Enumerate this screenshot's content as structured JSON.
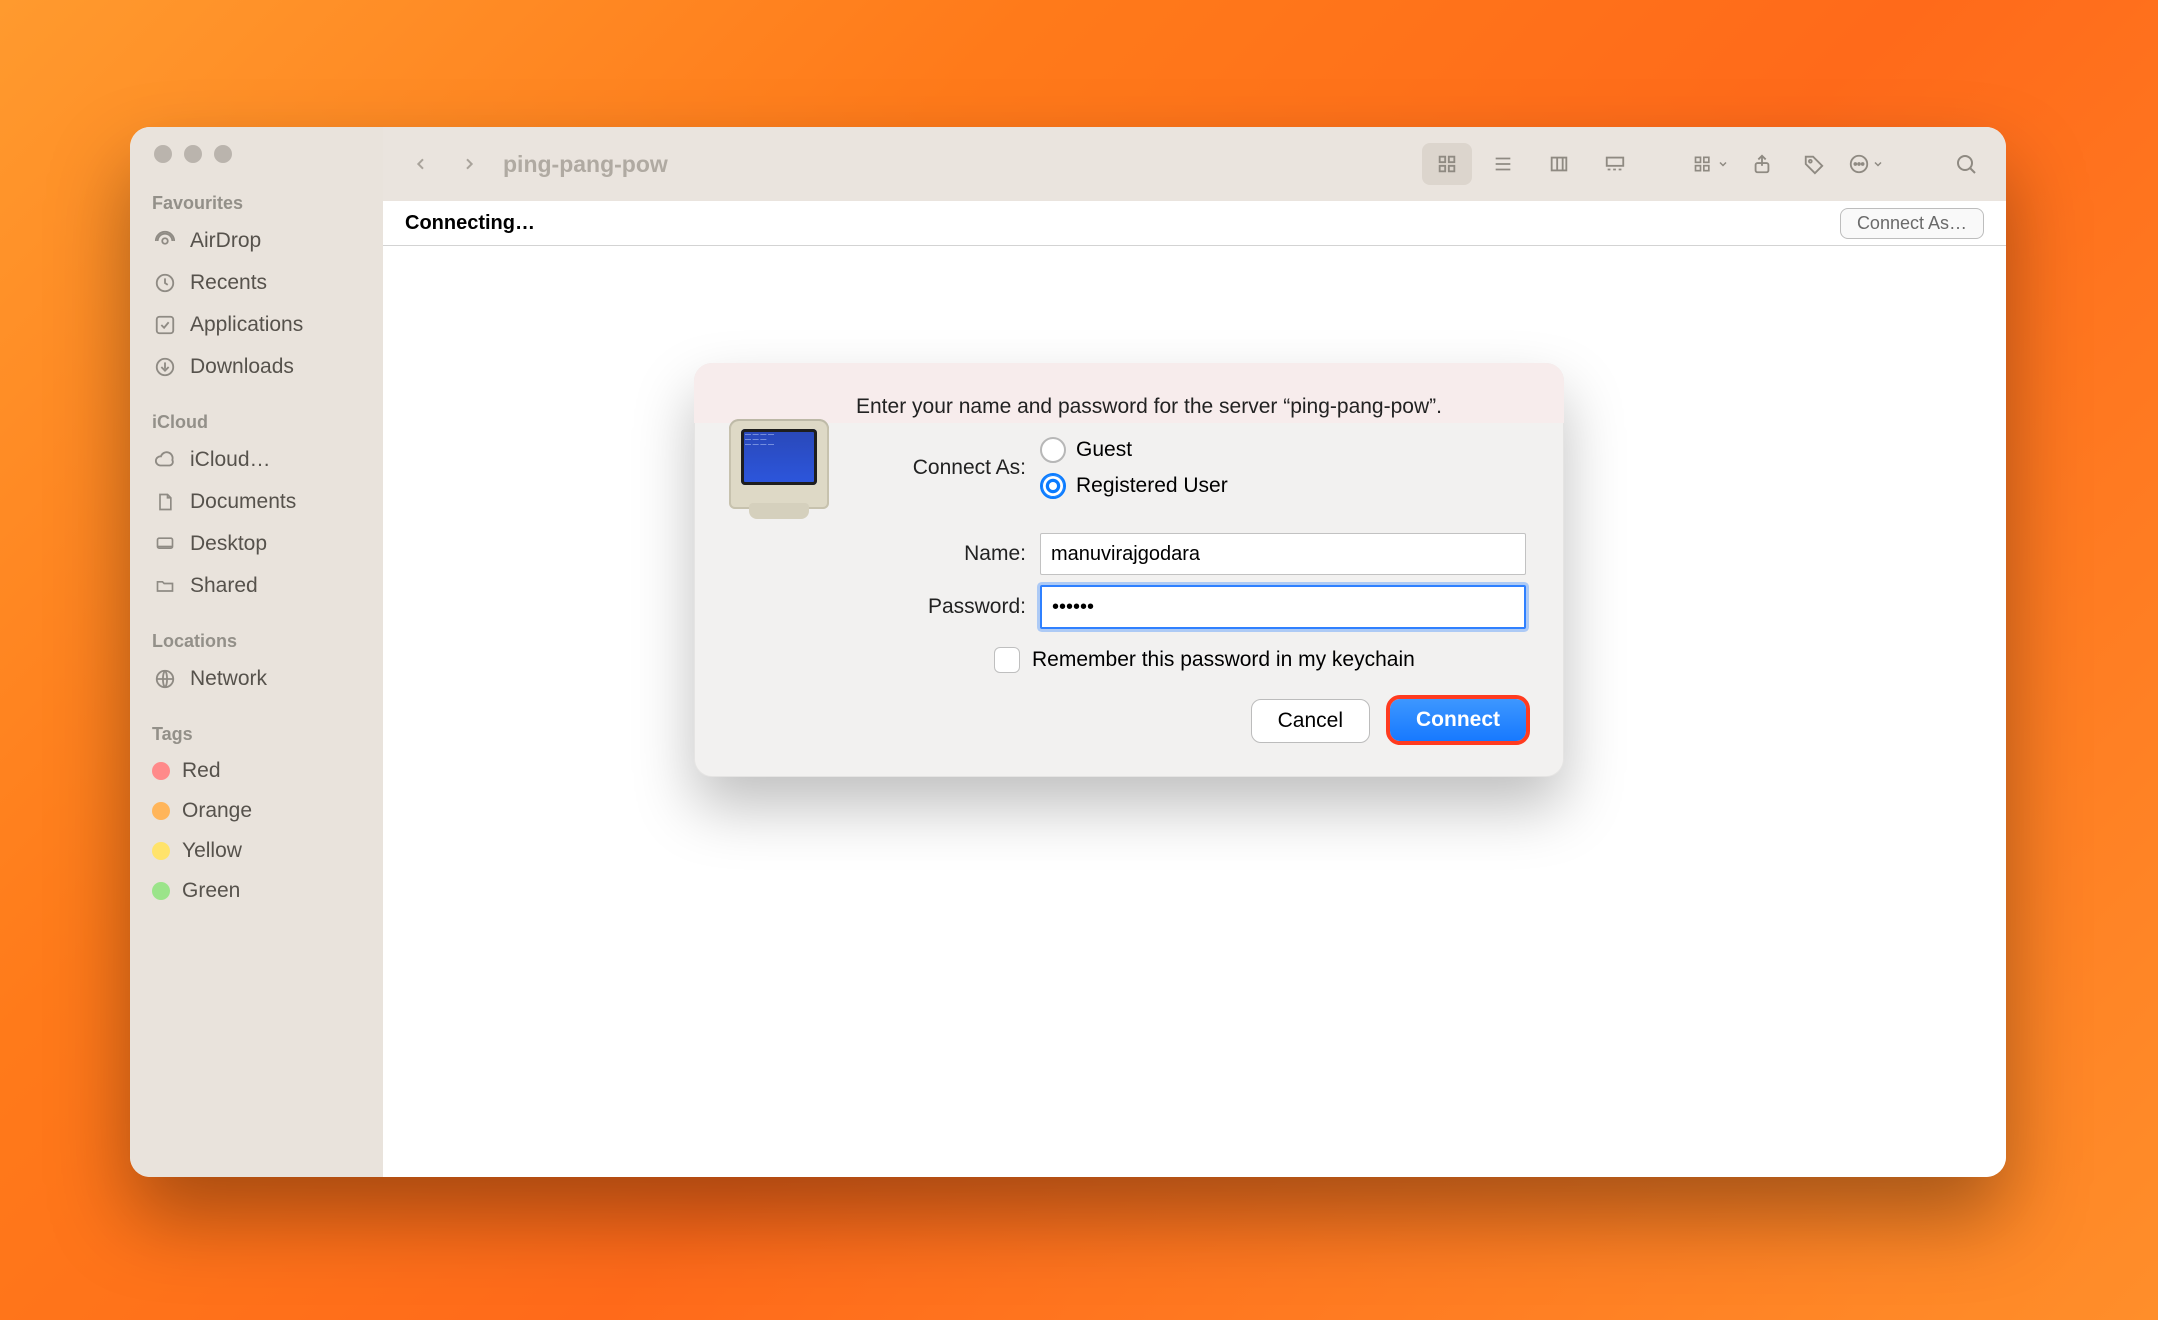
{
  "toolbar": {
    "folder_title": "ping-pang-pow"
  },
  "status_bar": {
    "status_text": "Connecting…",
    "connect_as_label": "Connect As…"
  },
  "sidebar": {
    "sections": {
      "favourites_title": "Favourites",
      "icloud_title": "iCloud",
      "locations_title": "Locations",
      "tags_title": "Tags"
    },
    "favourites": [
      "AirDrop",
      "Recents",
      "Applications",
      "Downloads"
    ],
    "icloud": [
      "iCloud…",
      "Documents",
      "Desktop",
      "Shared"
    ],
    "locations": [
      "Network"
    ],
    "tags": [
      {
        "label": "Red",
        "color": "#ff6b6b"
      },
      {
        "label": "Orange",
        "color": "#ffad42"
      },
      {
        "label": "Yellow",
        "color": "#ffe14a"
      },
      {
        "label": "Green",
        "color": "#8fe27a"
      }
    ]
  },
  "dialog": {
    "message": "Enter your name and password for the server “ping-pang-pow”.",
    "connect_as_label": "Connect As:",
    "guest_label": "Guest",
    "registered_user_label": "Registered User",
    "selected_mode": "registered",
    "name_label": "Name:",
    "name_value": "manuvirajgodara",
    "password_label": "Password:",
    "password_value_masked": "••••••",
    "remember_label": "Remember this password in my keychain",
    "remember_checked": false,
    "cancel_label": "Cancel",
    "connect_label": "Connect"
  }
}
